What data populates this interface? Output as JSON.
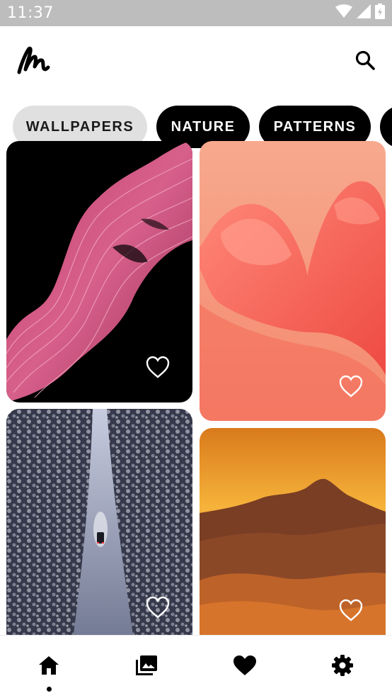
{
  "status_bar": {
    "time": "11:37"
  },
  "app": {
    "logo_icon": "signature-logo-icon",
    "search_icon": "search-icon"
  },
  "categories": {
    "selected": "WALLPAPERS",
    "items": [
      "WALLPAPERS",
      "NATURE",
      "PATTERNS"
    ]
  },
  "wallpapers": [
    {
      "subject": "pink-waves",
      "favorited": false
    },
    {
      "subject": "coral-ribbon",
      "favorited": false
    },
    {
      "subject": "snowy-forest-road",
      "favorited": false
    },
    {
      "subject": "mountain-sunset",
      "favorited": false
    }
  ],
  "bottom_nav": {
    "items": [
      "home-icon",
      "gallery-icon",
      "favorites-icon",
      "settings-icon"
    ],
    "active": "home-icon"
  }
}
